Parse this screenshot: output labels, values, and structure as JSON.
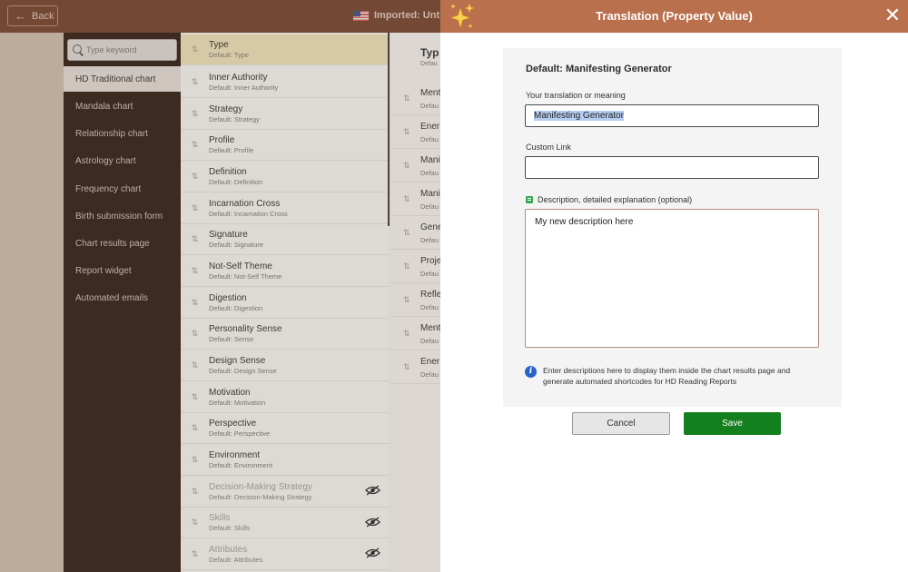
{
  "app": {
    "back_label": "Back",
    "imported_label": "Imported: Untitle"
  },
  "search": {
    "placeholder": "Type keyword"
  },
  "sidebar": {
    "items": [
      {
        "label": "HD Traditional chart",
        "active": true
      },
      {
        "label": "Mandala chart"
      },
      {
        "label": "Relationship chart"
      },
      {
        "label": "Astrology chart"
      },
      {
        "label": "Frequency chart"
      },
      {
        "label": "Birth submission form"
      },
      {
        "label": "Chart results page"
      },
      {
        "label": "Report widget"
      },
      {
        "label": "Automated emails"
      }
    ]
  },
  "properties": [
    {
      "name": "Type",
      "default": "Default: Type"
    },
    {
      "name": "Inner Authority",
      "default": "Default: Inner Authority"
    },
    {
      "name": "Strategy",
      "default": "Default: Strategy"
    },
    {
      "name": "Profile",
      "default": "Default: Profile"
    },
    {
      "name": "Definition",
      "default": "Default: Definition"
    },
    {
      "name": "Incarnation Cross",
      "default": "Default: Incarnation Cross"
    },
    {
      "name": "Signature",
      "default": "Default: Signature"
    },
    {
      "name": "Not-Self Theme",
      "default": "Default: Not-Self Theme"
    },
    {
      "name": "Digestion",
      "default": "Default: Digestion"
    },
    {
      "name": "Personality Sense",
      "default": "Default: Sense"
    },
    {
      "name": "Design Sense",
      "default": "Default: Design Sense"
    },
    {
      "name": "Motivation",
      "default": "Default: Motivation"
    },
    {
      "name": "Perspective",
      "default": "Default: Perspective"
    },
    {
      "name": "Environment",
      "default": "Default: Environment"
    },
    {
      "name": "Decision-Making Strategy",
      "default": "Default: Decision-Making Strategy"
    },
    {
      "name": "Skills",
      "default": "Default: Skills"
    },
    {
      "name": "Attributes",
      "default": "Default: Attributes"
    }
  ],
  "values_column": {
    "header": "Typ",
    "header_sub": "Defau",
    "rows": [
      {
        "name": "Ment",
        "default": "Defau"
      },
      {
        "name": "Ener",
        "default": "Defau"
      },
      {
        "name": "Mani",
        "default": "Defau"
      },
      {
        "name": "Mani",
        "default": "Defau"
      },
      {
        "name": "Gene",
        "default": "Defau"
      },
      {
        "name": "Proje",
        "default": "Defau"
      },
      {
        "name": "Refle",
        "default": "Defau"
      },
      {
        "name": "Ment",
        "default": "Defau"
      },
      {
        "name": "Ener",
        "default": "Defau"
      }
    ]
  },
  "panel": {
    "title": "Translation (Property Value)",
    "heading": "Default: Manifesting Generator",
    "translation_label": "Your translation or meaning",
    "translation_value": "Manifesting Generator",
    "link_label": "Custom Link",
    "link_value": "",
    "description_label": "Description, detailed explanation (optional)",
    "description_value": "My new description here",
    "info_text": "Enter descriptions here to display them inside the chart results page and generate automated shortcodes for HD Reading Reports",
    "cancel_label": "Cancel",
    "save_label": "Save"
  },
  "colors": {
    "header": "#ba6f4d",
    "topbar": "#6e3f2a",
    "sidebar": "#2d1c14",
    "save": "#137f1e",
    "info": "#2a62c9"
  }
}
